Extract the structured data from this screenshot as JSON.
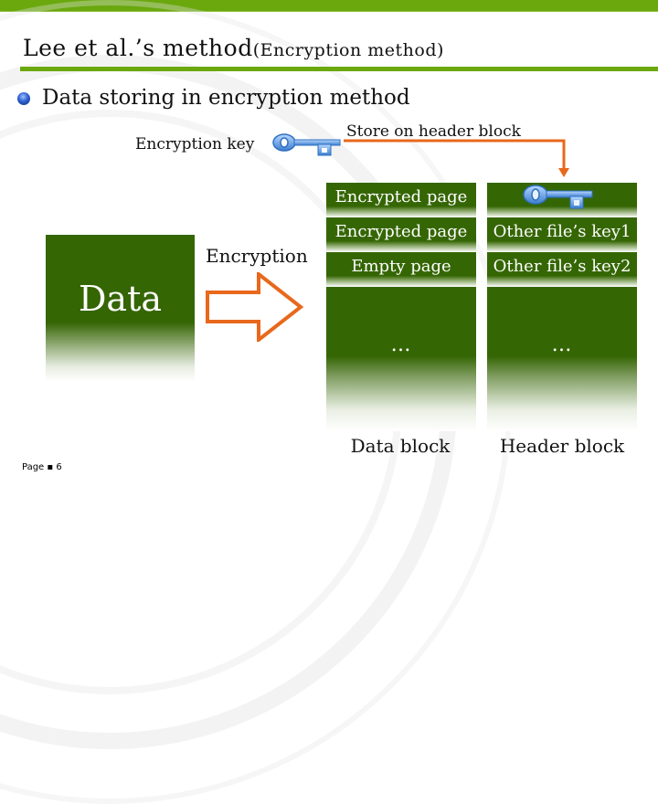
{
  "slide": {
    "title_main": "Lee et al.’s method",
    "title_sub": "(Encryption method)",
    "bullet": "Data storing in encryption method",
    "page_label": "Page ▪ 6"
  },
  "diagram": {
    "encryption_key_label": "Encryption key",
    "store_label": "Store on header block",
    "source_block": "Data",
    "process_label": "Encryption",
    "data_block": {
      "label": "Data block",
      "rows": [
        "Encrypted page",
        "Encrypted page",
        "Empty page",
        "…"
      ]
    },
    "header_block": {
      "label": "Header block",
      "rows": [
        "",
        "Other file’s key1",
        "Other file’s key2",
        "…"
      ]
    },
    "icons": {
      "encryption_key": "key-icon",
      "stored_key": "key-icon",
      "bullet": "bullet-icon"
    },
    "colors": {
      "accent_green": "#6aa80e",
      "block_green": "#356604",
      "arrow_orange": "#e8681c",
      "key_blue": "#5b9bde"
    }
  }
}
